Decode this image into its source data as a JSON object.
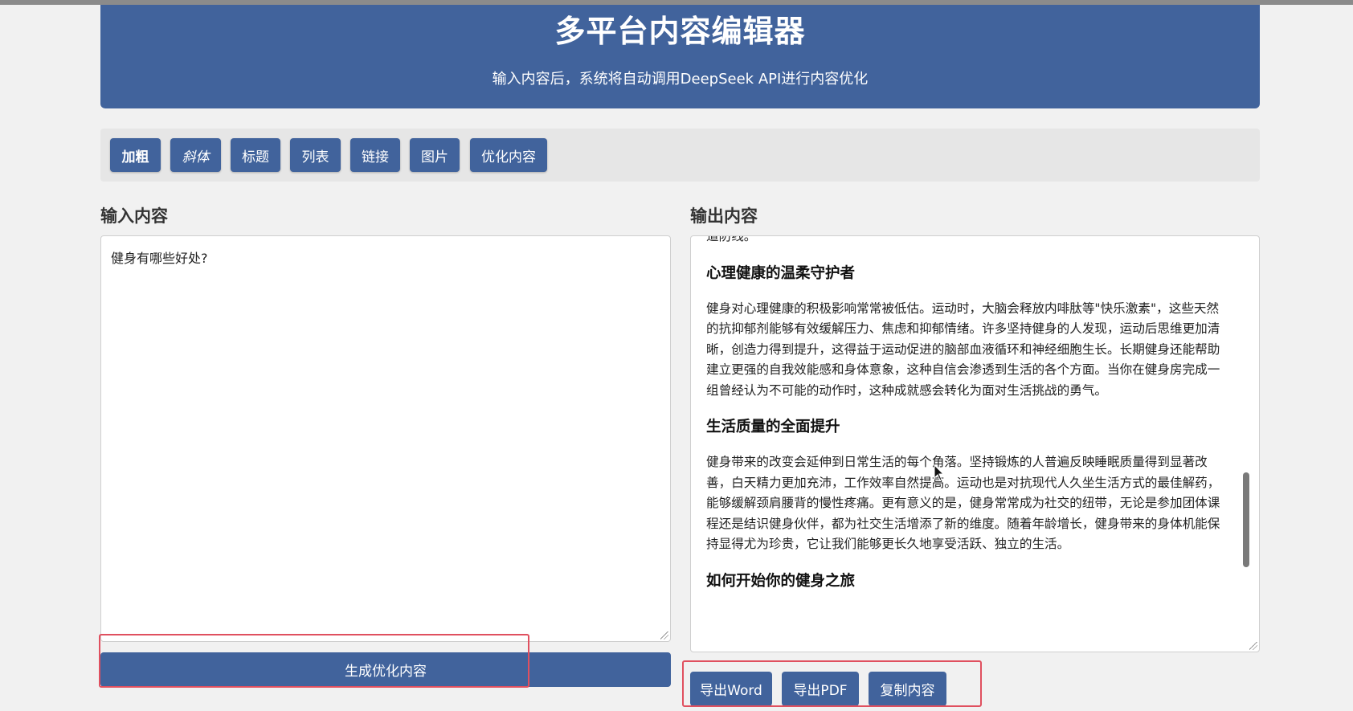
{
  "header": {
    "title": "多平台内容编辑器",
    "subtitle": "输入内容后，系统将自动调用DeepSeek API进行内容优化"
  },
  "toolbar": {
    "bold": "加粗",
    "italic": "斜体",
    "heading": "标题",
    "list": "列表",
    "link": "链接",
    "image": "图片",
    "optimize": "优化内容"
  },
  "input": {
    "title": "输入内容",
    "value": "健身有哪些好处?"
  },
  "output": {
    "title": "输出内容",
    "partial_paragraph": "道防线。",
    "sections": [
      {
        "heading": "心理健康的温柔守护者",
        "body": "健身对心理健康的积极影响常常被低估。运动时，大脑会释放内啡肽等\"快乐激素\"，这些天然的抗抑郁剂能够有效缓解压力、焦虑和抑郁情绪。许多坚持健身的人发现，运动后思维更加清晰，创造力得到提升，这得益于运动促进的脑部血液循环和神经细胞生长。长期健身还能帮助建立更强的自我效能感和身体意象，这种自信会渗透到生活的各个方面。当你在健身房完成一组曾经认为不可能的动作时，这种成就感会转化为面对生活挑战的勇气。"
      },
      {
        "heading": "生活质量的全面提升",
        "body": "健身带来的改变会延伸到日常生活的每个角落。坚持锻炼的人普遍反映睡眠质量得到显著改善，白天精力更加充沛，工作效率自然提高。运动也是对抗现代人久坐生活方式的最佳解药，能够缓解颈肩腰背的慢性疼痛。更有意义的是，健身常常成为社交的纽带，无论是参加团体课程还是结识健身伙伴，都为社交生活增添了新的维度。随着年龄增长，健身带来的身体机能保持显得尤为珍贵，它让我们能够更长久地享受活跃、独立的生活。"
      },
      {
        "heading": "如何开始你的健身之旅",
        "body": ""
      }
    ]
  },
  "actions": {
    "generate": "生成优化内容",
    "export_word": "导出Word",
    "export_pdf": "导出PDF",
    "copy": "复制内容"
  },
  "colors": {
    "primary": "#41639c",
    "highlight": "#e0505f",
    "background": "#f1f1f1"
  }
}
